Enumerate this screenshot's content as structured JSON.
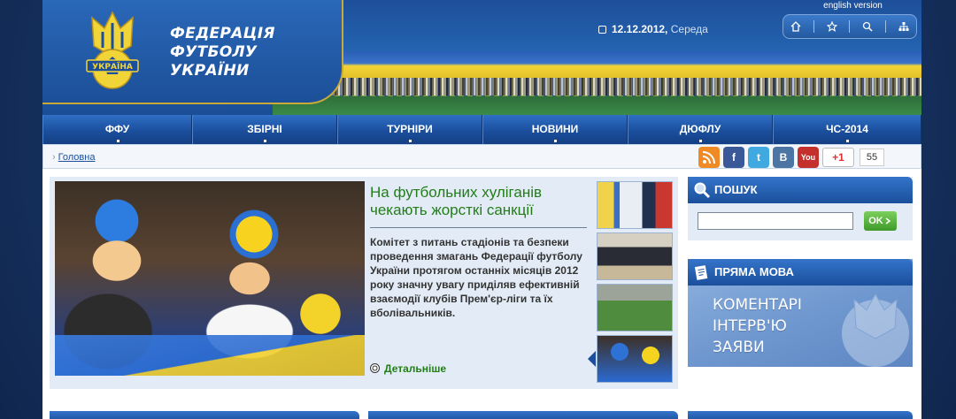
{
  "header": {
    "federation_name": [
      "ФЕДЕРАЦІЯ",
      "ФУТБОЛУ",
      "УКРАЇНИ"
    ],
    "emblem_text": "УКРАЇНА",
    "date": "12.12.2012,",
    "weekday": "Середа",
    "english_link": "english version",
    "toolbar_icons": [
      "home-icon",
      "star-icon",
      "search-icon",
      "sitemap-icon"
    ]
  },
  "nav": {
    "items": [
      {
        "label": "ФФУ"
      },
      {
        "label": "ЗБІРНІ"
      },
      {
        "label": "ТУРНІРИ"
      },
      {
        "label": "НОВИНИ"
      },
      {
        "label": "ДЮФЛУ"
      },
      {
        "label": "ЧС-2014"
      }
    ]
  },
  "breadcrumb": {
    "home": "Головна"
  },
  "social": {
    "rss": "rss-icon",
    "facebook": "f",
    "twitter": "t",
    "vkontakte": "B",
    "youtube": "You",
    "gplus_label": "+1",
    "gplus_count": "55",
    "colors": {
      "rss": "#f08a24",
      "facebook": "#3b5998",
      "twitter": "#3fa9e0",
      "vkontakte": "#4c75a3",
      "youtube": "#c4302b"
    }
  },
  "news": {
    "headline": "На футбольних хуліганів чекають жорсткі санкції",
    "summary": "Комітет з питань стадіонів та безпеки проведення змагань Федерації футболу України протягом останніх місяців 2012 року значну увагу приділяв ефективній взаємодії клубів Прем'єр-ліги та їх вболівальників.",
    "more": "Детальніше"
  },
  "search": {
    "title": "ПОШУК",
    "placeholder": "",
    "button": "OK"
  },
  "speech": {
    "title": "ПРЯМА МОВА",
    "links": [
      "КОМЕНТАРІ",
      "ІНТЕРВ'Ю",
      "ЗАЯВИ"
    ]
  },
  "colors": {
    "primary_blue": "#1b4f9d",
    "headline_green": "#227d18",
    "ukraine_yellow": "#f1d437"
  }
}
